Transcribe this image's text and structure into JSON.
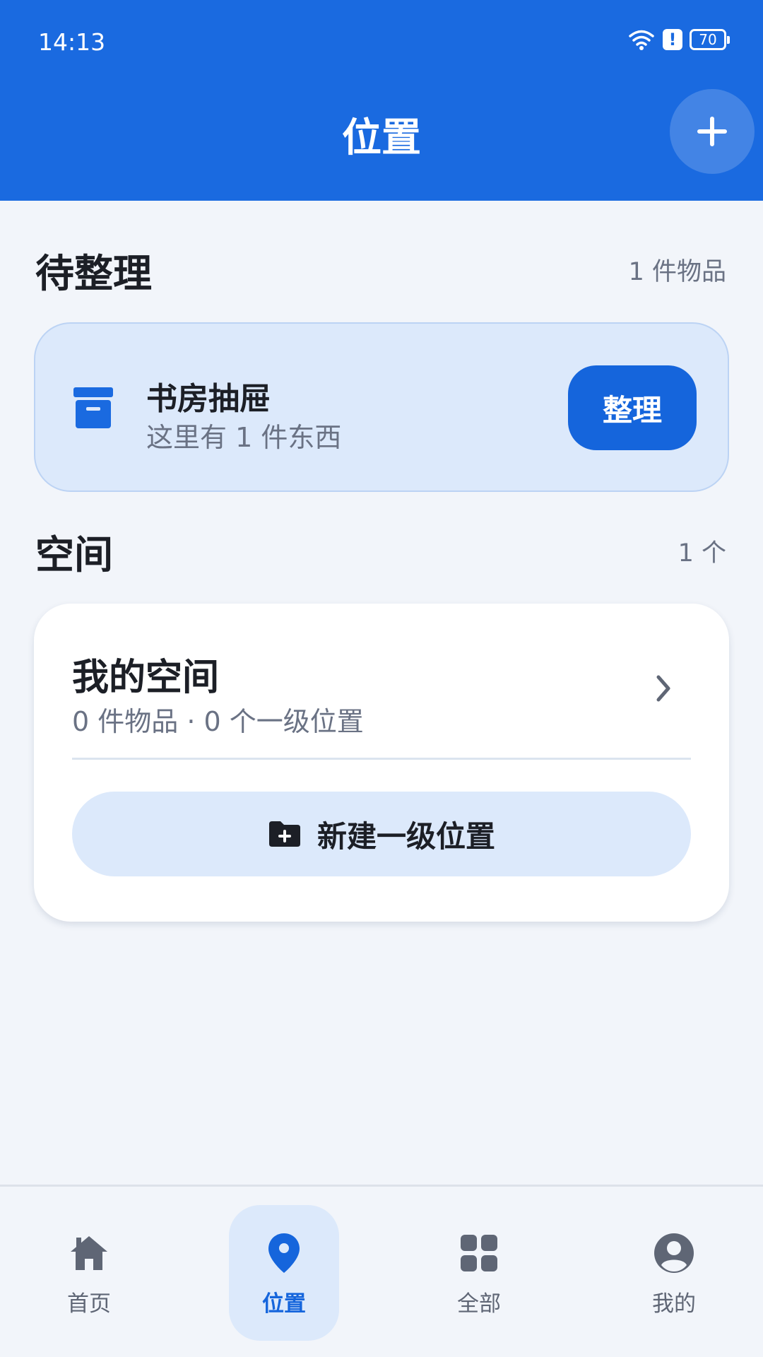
{
  "status_bar": {
    "time": "14:13",
    "battery": "70"
  },
  "header": {
    "title": "位置"
  },
  "pending": {
    "title": "待整理",
    "count": "1 件物品",
    "card": {
      "name": "书房抽屉",
      "description": "这里有 1 件东西",
      "button_label": "整理"
    }
  },
  "spaces": {
    "title": "空间",
    "count": "1 个",
    "card": {
      "name": "我的空间",
      "meta": "0 件物品 · 0 个一级位置",
      "new_location_label": "新建一级位置"
    }
  },
  "bottom_nav": [
    {
      "label": "首页",
      "icon": "home-icon"
    },
    {
      "label": "位置",
      "icon": "location-pin-icon",
      "active": true
    },
    {
      "label": "全部",
      "icon": "grid-icon"
    },
    {
      "label": "我的",
      "icon": "account-icon"
    }
  ],
  "colors": {
    "primary": "#1a6ae0",
    "accent_light": "#dce9fb",
    "background": "#f2f5fa"
  }
}
